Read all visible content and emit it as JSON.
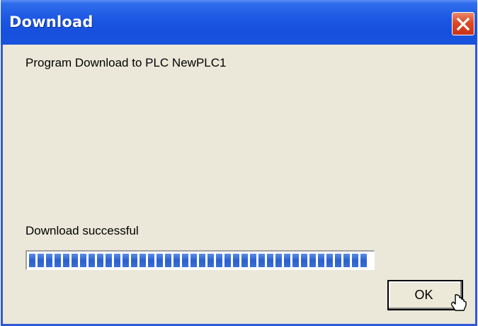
{
  "window": {
    "title": "Download",
    "close_icon": "close-icon",
    "colors": {
      "title_bar": "#1b56e2",
      "close_button": "#dd4a25",
      "body": "#ebe8da",
      "progress_fill": "#2b5fce"
    }
  },
  "dialog": {
    "message": "Program Download to PLC NewPLC1",
    "status": "Download successful",
    "progress_percent": 100,
    "ok_label": "OK"
  },
  "cursor": {
    "icon": "mouse-pointer-icon"
  }
}
